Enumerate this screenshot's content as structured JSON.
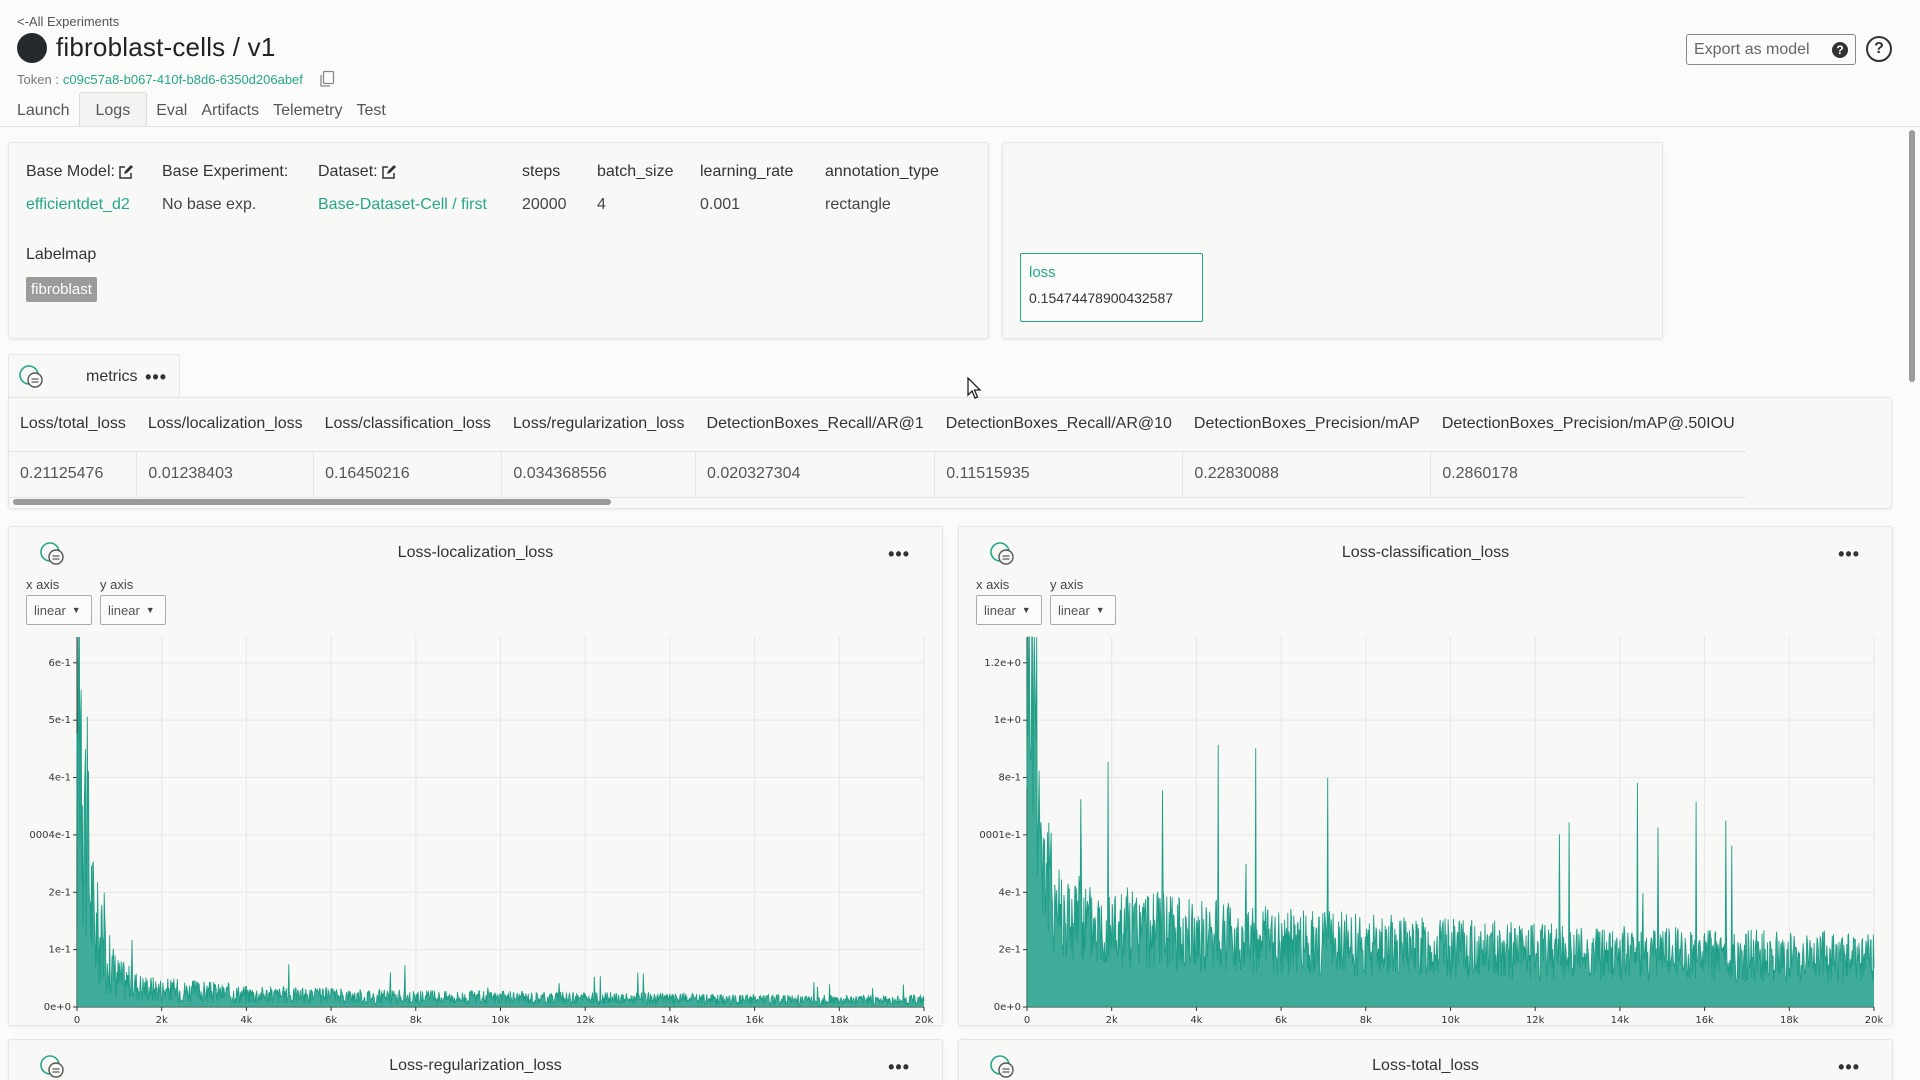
{
  "header": {
    "back_link": "<-All Experiments",
    "title": "fibroblast-cells / v1",
    "token_label": "Token :",
    "token_value": "c09c57a8-b067-410f-b8d6-6350d206abef",
    "export_label": "Export as model",
    "export_help": "?",
    "help": "?"
  },
  "tabs": [
    "Launch",
    "Logs",
    "Eval",
    "Artifacts",
    "Telemetry",
    "Test"
  ],
  "active_tab": "Logs",
  "info": {
    "base_model_label": "Base Model:",
    "base_model_value": "efficientdet_d2",
    "base_experiment_label": "Base Experiment:",
    "base_experiment_value": "No base exp.",
    "dataset_label": "Dataset:",
    "dataset_value": "Base-Dataset-Cell / first",
    "steps_label": "steps",
    "steps_value": "20000",
    "batch_size_label": "batch_size",
    "batch_size_value": "4",
    "learning_rate_label": "learning_rate",
    "learning_rate_value": "0.001",
    "annotation_type_label": "annotation_type",
    "annotation_type_value": "rectangle",
    "labelmap_label": "Labelmap",
    "labelmap_items": [
      "fibroblast"
    ]
  },
  "loss_card": {
    "label": "loss",
    "value": "0.15474478900432587"
  },
  "metrics": {
    "tab_label": "metrics",
    "dots": "•••",
    "columns": [
      "Loss/total_loss",
      "Loss/localization_loss",
      "Loss/classification_loss",
      "Loss/regularization_loss",
      "DetectionBoxes_Recall/AR@1",
      "DetectionBoxes_Recall/AR@10",
      "DetectionBoxes_Precision/mAP",
      "DetectionBoxes_Precision/mAP@.50IOU"
    ],
    "values": [
      "0.21125476",
      "0.01238403",
      "0.16450216",
      "0.034368556",
      "0.020327304",
      "0.11515935",
      "0.22830088",
      "0.2860178"
    ]
  },
  "axis_controls": {
    "x_caption": "x axis",
    "y_caption": "y axis",
    "x_value": "linear",
    "y_value": "linear"
  },
  "chart_titles": [
    "Loss-localization_loss",
    "Loss-classification_loss",
    "Loss-regularization_loss",
    "Loss-total_loss"
  ],
  "colors": {
    "accent": "#27a58a",
    "series": "#1f9e87"
  },
  "chart_data": [
    {
      "type": "line",
      "title": "Loss-localization_loss",
      "xlabel": "",
      "ylabel": "",
      "x_ticks": [
        "0",
        "2k",
        "4k",
        "6k",
        "8k",
        "10k",
        "12k",
        "14k",
        "16k",
        "18k",
        "20k"
      ],
      "y_ticks": [
        "0e+0",
        "1e-1",
        "2e-1",
        "0004e-1",
        "4e-1",
        "5e-1",
        "6e-1"
      ],
      "xlim": [
        0,
        20000
      ],
      "ylim": [
        0,
        0.69
      ],
      "series": [
        {
          "x": [
            0,
            60,
            100,
            150,
            200,
            300,
            400,
            600,
            800,
            1000,
            1500,
            2000,
            3000,
            4000,
            5000,
            6000,
            8000,
            10000,
            12000,
            14000,
            16000,
            18000,
            20000
          ],
          "y": [
            0.3,
            0.68,
            0.55,
            0.45,
            0.34,
            0.22,
            0.15,
            0.1,
            0.07,
            0.05,
            0.035,
            0.03,
            0.026,
            0.022,
            0.02,
            0.019,
            0.017,
            0.016,
            0.015,
            0.014,
            0.013,
            0.012,
            0.012
          ]
        }
      ],
      "grid": true
    },
    {
      "type": "line",
      "title": "Loss-classification_loss",
      "xlabel": "",
      "ylabel": "",
      "x_ticks": [
        "0",
        "2k",
        "4k",
        "6k",
        "8k",
        "10k",
        "12k",
        "14k",
        "16k",
        "18k",
        "20k"
      ],
      "y_ticks": [
        "0e+0",
        "2e-1",
        "4e-1",
        "0001e-1",
        "8e-1",
        "1e+0",
        "1.2e+0"
      ],
      "xlim": [
        0,
        20000
      ],
      "ylim": [
        0,
        1.2
      ],
      "series": [
        {
          "x": [
            0,
            50,
            100,
            200,
            300,
            400,
            600,
            800,
            1000,
            1500,
            2000,
            3000,
            4000,
            5000,
            6000,
            8000,
            10000,
            12000,
            14000,
            16000,
            18000,
            20000
          ],
          "y": [
            1.1,
            1.17,
            1.12,
            1.0,
            0.6,
            0.45,
            0.35,
            0.3,
            0.28,
            0.26,
            0.25,
            0.24,
            0.22,
            0.21,
            0.2,
            0.19,
            0.18,
            0.17,
            0.165,
            0.16,
            0.155,
            0.15
          ]
        }
      ],
      "grid": true
    }
  ]
}
